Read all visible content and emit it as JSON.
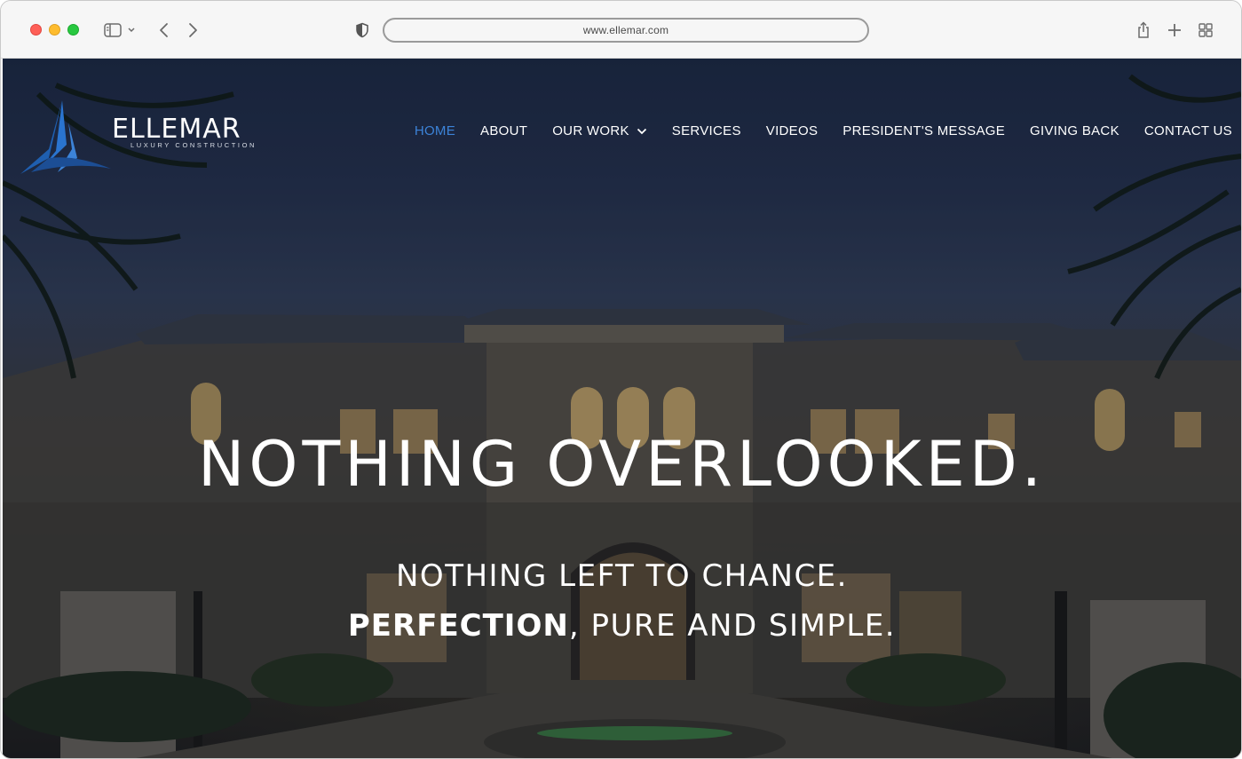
{
  "browser": {
    "url": "www.ellemar.com"
  },
  "site": {
    "logo_name": "ELLEMAR",
    "logo_tagline": "LUXURY CONSTRUCTION",
    "accent_color": "#3c83d8",
    "nav": [
      {
        "label": "HOME",
        "active": true
      },
      {
        "label": "ABOUT"
      },
      {
        "label": "OUR WORK"
      },
      {
        "label": "SERVICES"
      },
      {
        "label": "VIDEOS"
      },
      {
        "label": "PRESIDENT'S MESSAGE"
      },
      {
        "label": "GIVING BACK"
      },
      {
        "label": "CONTACT US"
      }
    ]
  },
  "hero": {
    "title": "NOTHING OVERLOOKED.",
    "line1": "NOTHING LEFT TO CHANCE.",
    "line2_bold": "PERFECTION",
    "line2_rest": ", PURE AND SIMPLE."
  }
}
